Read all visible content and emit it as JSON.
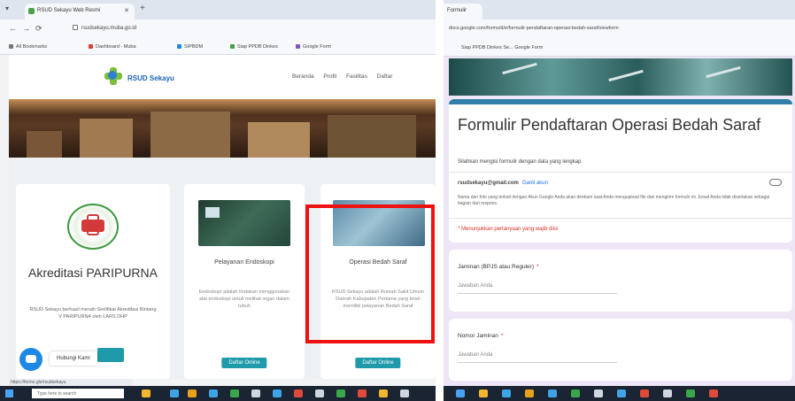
{
  "left": {
    "tab_title": "RSUD Sekayu Web Resmi",
    "url": "rsudsekayu.muba.go.id",
    "bookmarks": [
      "All Bookmarks",
      "Dashboard - Muba",
      "SIPBDM",
      "Siap PPDB Dinkes",
      "Google Form"
    ],
    "site_logo_text": "RSUD Sekayu",
    "nav": [
      "Beranda",
      "Profil",
      "Fasilitas",
      "Daftar"
    ],
    "card1": {
      "title": "Akreditasi PARIPURNA",
      "desc": "RSUD Sekayu berhasil meraih Sertifikat Akreditasi Bintang V PARIPURNA oleh LARS DHP"
    },
    "card2": {
      "title": "Pelayanan Endoskopi",
      "desc": "Endoskopi adalah tindakan menggunakan alat endoskopi untuk melihat organ dalam tubuh",
      "button": "Daftar Online"
    },
    "card3": {
      "title": "Operasi Bedah Saraf",
      "desc": "RSUD Sekayu adalah Rumah Sakit Umum Daerah Kabupaten Pertama yang telah memiliki pelayanan Bedah Saraf",
      "button": "Daftar Online"
    },
    "chat_label": "Hubungi Kami",
    "status_url": "https://forms.gle/rsudsekayu",
    "search_placeholder": "Type here to search"
  },
  "right": {
    "tab_title": "Formulir",
    "url": "docs.google.com/forms/d/e/formulir-pendaftaran-operasi-bedah-saraf/viewform",
    "bookmarks": "Siap PPDB Dinkes Se...   Google Form",
    "form_title": "Formulir Pendaftaran Operasi Bedah Saraf",
    "form_subtitle": "Silahkan mengisi formulir dengan data yang lengkap",
    "email": "rsudsekayu@gmail.com",
    "switch_account": "Ganti akun",
    "note": "Nama dan foto yang terkait dengan Akun Google Anda akan direkam saat Anda mengupload file dan mengirim formulir ini. Email Anda tidak disertakan sebagai bagian dari respons.",
    "required_note": "* Menunjukkan pertanyaan yang wajib diisi",
    "questions": [
      {
        "label": "Jaminan (BPJS atau Reguler)",
        "placeholder": "Jawaban Anda"
      },
      {
        "label": "Nomor Jaminan",
        "placeholder": "Jawaban Anda"
      }
    ]
  },
  "colors": {
    "highlight": "#ee1111",
    "form_accent": "#2f7fa8",
    "site_button": "#1f9aaa",
    "required": "#d93025"
  }
}
